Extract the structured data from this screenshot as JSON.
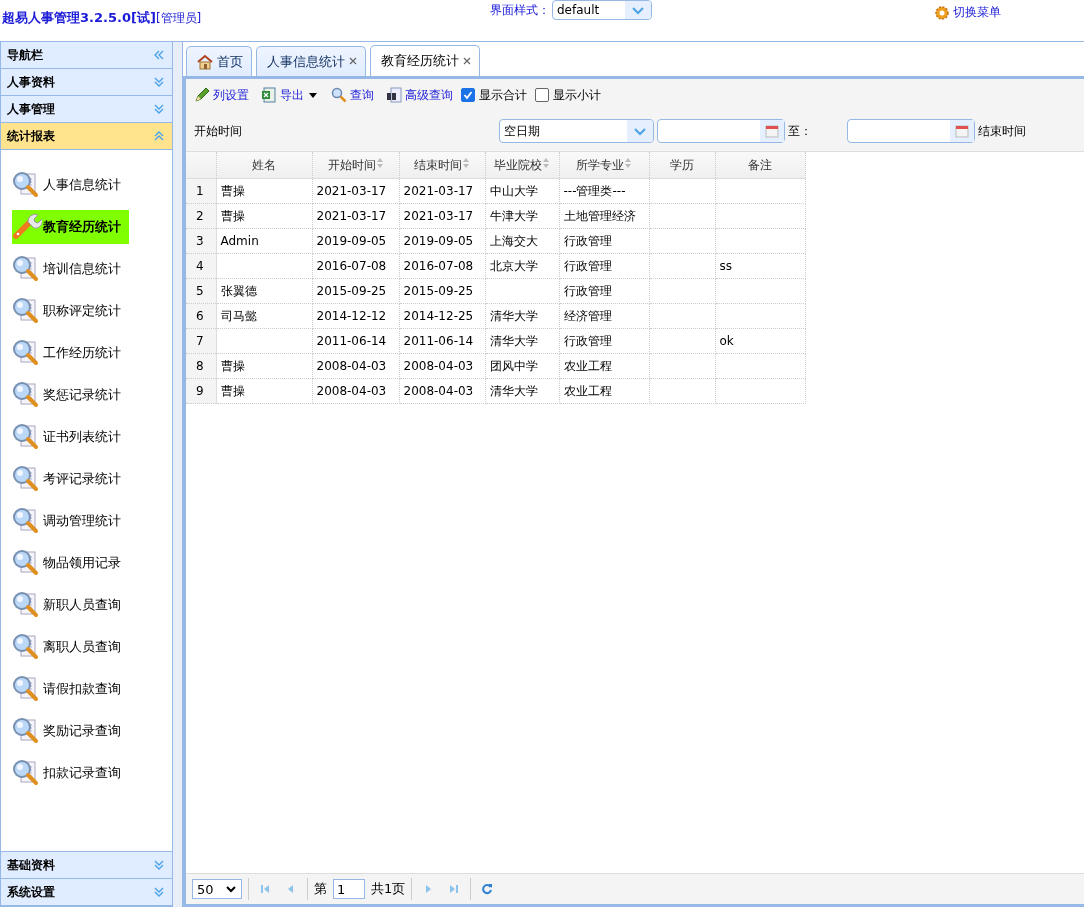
{
  "app": {
    "title": "超易人事管理3.2.5.0[试]",
    "role": "[管理员]"
  },
  "theme": {
    "label": "界面样式：",
    "value": "default"
  },
  "switch_menu": "切换菜单",
  "sidebar": {
    "title": "导航栏",
    "sections": [
      {
        "label": "人事资料",
        "expanded": false
      },
      {
        "label": "人事管理",
        "expanded": false
      },
      {
        "label": "统计报表",
        "expanded": true,
        "items": [
          {
            "label": "人事信息统计",
            "selected": false
          },
          {
            "label": "教育经历统计",
            "selected": true
          },
          {
            "label": "培训信息统计",
            "selected": false
          },
          {
            "label": "职称评定统计",
            "selected": false
          },
          {
            "label": "工作经历统计",
            "selected": false
          },
          {
            "label": "奖惩记录统计",
            "selected": false
          },
          {
            "label": "证书列表统计",
            "selected": false
          },
          {
            "label": "考评记录统计",
            "selected": false
          },
          {
            "label": "调动管理统计",
            "selected": false
          },
          {
            "label": "物品领用记录",
            "selected": false
          },
          {
            "label": "新职人员查询",
            "selected": false
          },
          {
            "label": "离职人员查询",
            "selected": false
          },
          {
            "label": "请假扣款查询",
            "selected": false
          },
          {
            "label": "奖励记录查询",
            "selected": false
          },
          {
            "label": "扣款记录查询",
            "selected": false
          }
        ]
      },
      {
        "label": "基础资料",
        "expanded": false
      },
      {
        "label": "系统设置",
        "expanded": false
      }
    ]
  },
  "tabs": [
    {
      "label": "首页",
      "kind": "home",
      "selected": false
    },
    {
      "label": "人事信息统计",
      "kind": "closable",
      "selected": false
    },
    {
      "label": "教育经历统计",
      "kind": "closable",
      "selected": true
    }
  ],
  "toolbar": {
    "buttons": [
      {
        "label": "列设置",
        "kind": "pencil"
      },
      {
        "label": "导出",
        "kind": "export"
      },
      {
        "label": "查询",
        "kind": "search"
      },
      {
        "label": "高级查询",
        "kind": "advanced"
      }
    ],
    "checkboxes": [
      {
        "label": "显示合计",
        "checked": true
      },
      {
        "label": "显示小计",
        "checked": false
      }
    ]
  },
  "filter": {
    "start_label": "开始时间",
    "date_mode": "空日期",
    "to_label": "至：",
    "end_label": "结束时间"
  },
  "table": {
    "columns": [
      {
        "label": "姓名",
        "sortable": false
      },
      {
        "label": "开始时间",
        "sortable": true
      },
      {
        "label": "结束时间",
        "sortable": true
      },
      {
        "label": "毕业院校",
        "sortable": true
      },
      {
        "label": "所学专业",
        "sortable": true
      },
      {
        "label": "学历",
        "sortable": false
      },
      {
        "label": "备注",
        "sortable": false
      }
    ],
    "rows": [
      {
        "num": "1",
        "cells": [
          "曹操",
          "2021-03-17",
          "2021-03-17",
          "中山大学",
          "---管理类---",
          "",
          ""
        ]
      },
      {
        "num": "2",
        "cells": [
          "曹操",
          "2021-03-17",
          "2021-03-17",
          "牛津大学",
          "土地管理经济",
          "",
          ""
        ]
      },
      {
        "num": "3",
        "cells": [
          "Admin",
          "2019-09-05",
          "2019-09-05",
          "上海交大",
          "行政管理",
          "",
          ""
        ]
      },
      {
        "num": "4",
        "cells": [
          "",
          "2016-07-08",
          "2016-07-08",
          "北京大学",
          "行政管理",
          "",
          "ss"
        ]
      },
      {
        "num": "5",
        "cells": [
          "张翼德",
          "2015-09-25",
          "2015-09-25",
          "",
          "行政管理",
          "",
          ""
        ]
      },
      {
        "num": "6",
        "cells": [
          "司马懿",
          "2014-12-12",
          "2014-12-25",
          "清华大学",
          "经济管理",
          "",
          ""
        ]
      },
      {
        "num": "7",
        "cells": [
          "",
          "2011-06-14",
          "2011-06-14",
          "清华大学",
          "行政管理",
          "",
          "ok"
        ]
      },
      {
        "num": "8",
        "cells": [
          "曹操",
          "2008-04-03",
          "2008-04-03",
          "团风中学",
          "农业工程",
          "",
          ""
        ]
      },
      {
        "num": "9",
        "cells": [
          "曹操",
          "2008-04-03",
          "2008-04-03",
          "清华大学",
          "农业工程",
          "",
          ""
        ]
      }
    ]
  },
  "pager": {
    "page_size": "50",
    "page_prefix": "第",
    "page": "1",
    "total": "共1页"
  }
}
